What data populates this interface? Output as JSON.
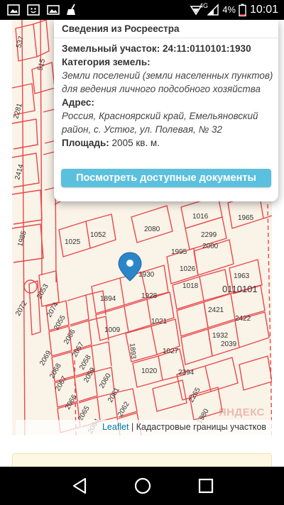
{
  "status_bar": {
    "network": "4G",
    "battery": "4%",
    "time": "10:01"
  },
  "popup": {
    "title": "Сведения из Росреестра",
    "parcel_label": "Земельный участок:",
    "parcel_value": "24:11:0110101:1930",
    "category_label": "Категория земель:",
    "category_line1": "Земли поселений (земли населенных пунктов)",
    "category_line2": "для ведения личного подсобного хозяйства",
    "address_label": "Адрес:",
    "address_line1": "Россия, Красноярский край, Емельяновский",
    "address_line2": "район, с. Устюг, ул. Полевая, № 32",
    "area_label": "Площадь:",
    "area_value": "2005 кв. м.",
    "button_label": "Посмотреть доступные документы"
  },
  "map": {
    "attribution_link": "Leaflet",
    "attribution_sep": "|",
    "attribution_text": "Кадастровые границы участков",
    "watermark": "ЯНДЕКС",
    "quarter_label": "0110101",
    "marker_icon": "map-marker-icon",
    "parcel_labels": [
      "537",
      "515",
      "2281",
      "2414",
      "1985",
      "1025",
      "1052",
      "2080",
      "1016",
      "1965",
      "2299",
      "1995",
      "2000",
      "1026",
      "1963",
      "1894",
      "1018",
      "2421",
      "1928",
      "1009",
      "2422",
      "1021",
      "1932",
      "1893",
      "2039",
      "1027",
      "1020",
      "2394",
      "2053",
      "2074",
      "2072",
      "2055",
      "2069",
      "2056",
      "2068",
      "2057",
      "2067",
      "2058",
      "2059",
      "2066",
      "2060",
      "2061",
      "2065",
      "2062",
      "2064",
      "2265",
      "1980",
      "1930"
    ]
  },
  "nav_bar": {
    "back_icon": "back-triangle-icon",
    "home_icon": "home-circle-icon",
    "recents_icon": "recents-square-icon"
  },
  "colors": {
    "parcel_line": "#e8474b",
    "map_bg": "#faf3e8",
    "button_bg": "#5bc0de",
    "marker": "#2b86c8",
    "card_bg": "#fcf8e3"
  }
}
